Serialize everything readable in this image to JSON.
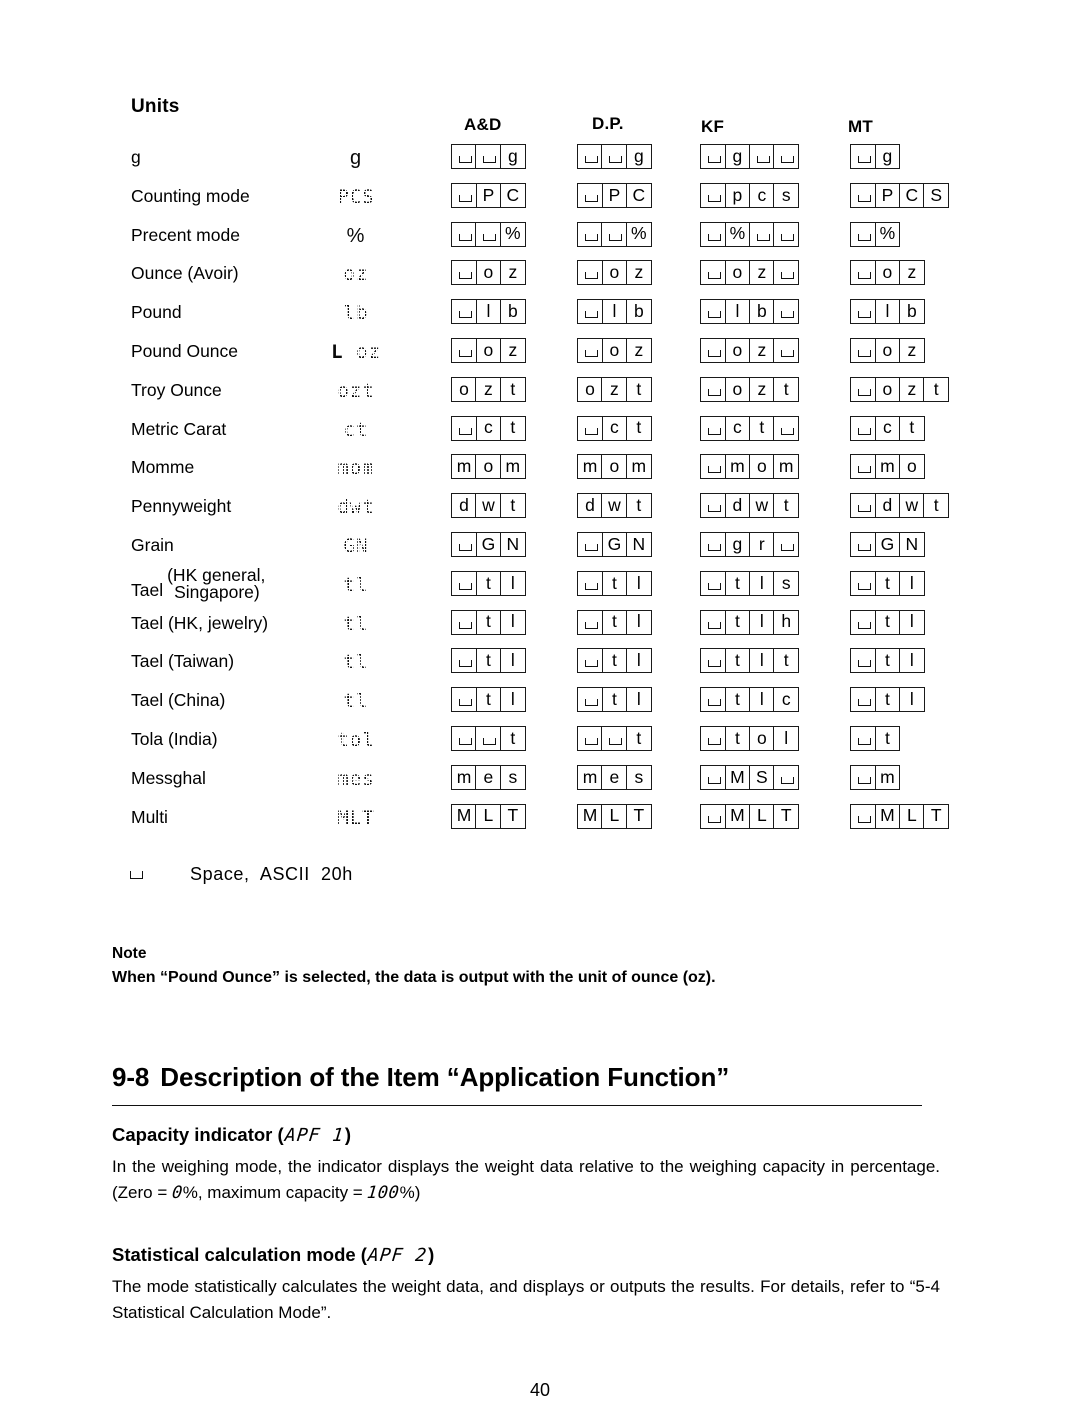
{
  "units": {
    "title": "Units",
    "column_headers": [
      "A&D",
      "D.P.",
      "KF",
      "MT"
    ],
    "rows": [
      {
        "name": "g",
        "lcd": "g",
        "lcd_style": "plain",
        "ad": [
          "_",
          "_",
          "g"
        ],
        "dp": [
          "_",
          "_",
          "g"
        ],
        "kf": [
          "_",
          "g",
          "_",
          "_"
        ],
        "mt": [
          "_",
          "g"
        ]
      },
      {
        "name": "Counting mode",
        "lcd": "PCS",
        "lcd_style": "dot",
        "ad": [
          "_",
          "P",
          "C"
        ],
        "dp": [
          "_",
          "P",
          "C"
        ],
        "kf": [
          "_",
          "p",
          "c",
          "s"
        ],
        "mt": [
          "_",
          "P",
          "C",
          "S"
        ]
      },
      {
        "name": "Precent mode",
        "lcd": "%",
        "lcd_style": "plain",
        "ad": [
          "_",
          "_",
          "%"
        ],
        "dp": [
          "_",
          "_",
          "%"
        ],
        "kf": [
          "_",
          "%",
          "_",
          "_"
        ],
        "mt": [
          "_",
          "%"
        ]
      },
      {
        "name": "Ounce (Avoir)",
        "lcd": "oz",
        "lcd_style": "dot",
        "ad": [
          "_",
          "o",
          "z"
        ],
        "dp": [
          "_",
          "o",
          "z"
        ],
        "kf": [
          "_",
          "o",
          "z",
          "_"
        ],
        "mt": [
          "_",
          "o",
          "z"
        ]
      },
      {
        "name": "Pound",
        "lcd": "lb",
        "lcd_style": "dot",
        "ad": [
          "_",
          "l",
          "b"
        ],
        "dp": [
          "_",
          "l",
          "b"
        ],
        "kf": [
          "_",
          "l",
          "b",
          "_"
        ],
        "mt": [
          "_",
          "l",
          "b"
        ]
      },
      {
        "name": "Pound Ounce",
        "lcd": "L oz",
        "lcd_style": "dot-L",
        "ad": [
          "_",
          "o",
          "z"
        ],
        "dp": [
          "_",
          "o",
          "z"
        ],
        "kf": [
          "_",
          "o",
          "z",
          "_"
        ],
        "mt": [
          "_",
          "o",
          "z"
        ]
      },
      {
        "name": "Troy Ounce",
        "lcd": "ozt",
        "lcd_style": "dot",
        "ad": [
          "o",
          "z",
          "t"
        ],
        "dp": [
          "o",
          "z",
          "t"
        ],
        "kf": [
          "_",
          "o",
          "z",
          "t"
        ],
        "mt": [
          "_",
          "o",
          "z",
          "t"
        ]
      },
      {
        "name": "Metric Carat",
        "lcd": "ct",
        "lcd_style": "dot",
        "ad": [
          "_",
          "c",
          "t"
        ],
        "dp": [
          "_",
          "c",
          "t"
        ],
        "kf": [
          "_",
          "c",
          "t",
          "_"
        ],
        "mt": [
          "_",
          "c",
          "t"
        ]
      },
      {
        "name": "Momme",
        "lcd": "mom",
        "lcd_style": "dot",
        "ad": [
          "m",
          "o",
          "m"
        ],
        "dp": [
          "m",
          "o",
          "m"
        ],
        "kf": [
          "_",
          "m",
          "o",
          "m"
        ],
        "mt": [
          "_",
          "m",
          "o"
        ]
      },
      {
        "name": "Pennyweight",
        "lcd": "dwt",
        "lcd_style": "dot",
        "ad": [
          "d",
          "w",
          "t"
        ],
        "dp": [
          "d",
          "w",
          "t"
        ],
        "kf": [
          "_",
          "d",
          "w",
          "t"
        ],
        "mt": [
          "_",
          "d",
          "w",
          "t"
        ]
      },
      {
        "name": "Grain",
        "lcd": "GN",
        "lcd_style": "dot",
        "ad": [
          "_",
          "G",
          "N"
        ],
        "dp": [
          "_",
          "G",
          "N"
        ],
        "kf": [
          "_",
          "g",
          "r",
          "_"
        ],
        "mt": [
          "_",
          "G",
          "N"
        ]
      },
      {
        "name": "Tael",
        "name_paren_line1": "(HK general,",
        "name_paren_line2": "Singapore)",
        "lcd": "tl",
        "lcd_style": "dot",
        "ad": [
          "_",
          "t",
          "l"
        ],
        "dp": [
          "_",
          "t",
          "l"
        ],
        "kf": [
          "_",
          "t",
          "l",
          "s"
        ],
        "mt": [
          "_",
          "t",
          "l"
        ]
      },
      {
        "name": "Tael (HK, jewelry)",
        "lcd": "tl",
        "lcd_style": "dot",
        "ad": [
          "_",
          "t",
          "l"
        ],
        "dp": [
          "_",
          "t",
          "l"
        ],
        "kf": [
          "_",
          "t",
          "l",
          "h"
        ],
        "mt": [
          "_",
          "t",
          "l"
        ]
      },
      {
        "name": "Tael (Taiwan)",
        "lcd": "tl",
        "lcd_style": "dot",
        "ad": [
          "_",
          "t",
          "l"
        ],
        "dp": [
          "_",
          "t",
          "l"
        ],
        "kf": [
          "_",
          "t",
          "l",
          "t"
        ],
        "mt": [
          "_",
          "t",
          "l"
        ]
      },
      {
        "name": "Tael (China)",
        "lcd": "tl",
        "lcd_style": "dot",
        "ad": [
          "_",
          "t",
          "l"
        ],
        "dp": [
          "_",
          "t",
          "l"
        ],
        "kf": [
          "_",
          "t",
          "l",
          "c"
        ],
        "mt": [
          "_",
          "t",
          "l"
        ]
      },
      {
        "name": "Tola (India)",
        "lcd": "tol",
        "lcd_style": "dot",
        "ad": [
          "_",
          "_",
          "t"
        ],
        "dp": [
          "_",
          "_",
          "t"
        ],
        "kf": [
          "_",
          "t",
          "o",
          "l"
        ],
        "mt": [
          "_",
          "t"
        ]
      },
      {
        "name": "Messghal",
        "lcd": "mes",
        "lcd_style": "dot",
        "ad": [
          "m",
          "e",
          "s"
        ],
        "dp": [
          "m",
          "e",
          "s"
        ],
        "kf": [
          "_",
          "M",
          "S",
          "_"
        ],
        "mt": [
          "_",
          "m"
        ]
      },
      {
        "name": "Multi",
        "lcd": "MLT",
        "lcd_style": "dot",
        "ad": [
          "M",
          "L",
          "T"
        ],
        "dp": [
          "M",
          "L",
          "T"
        ],
        "kf": [
          "_",
          "M",
          "L",
          "T"
        ],
        "mt": [
          "_",
          "M",
          "L",
          "T"
        ]
      }
    ]
  },
  "space_legend": {
    "glyph_name": "space-symbol",
    "text": "Space,  ASCII  20h"
  },
  "note": {
    "title": "Note",
    "body": "When “Pound Ounce” is selected, the data is output with the unit of ounce (oz)."
  },
  "section": {
    "number": "9-8",
    "title": "Description of the Item “Application Function”"
  },
  "capacity_indicator": {
    "heading_prefix": "Capacity indicator (",
    "heading_code": "APF  1",
    "heading_suffix": ")",
    "para_part1": "In the weighing mode, the indicator displays the weight data relative to the weighing capacity in percentage. (Zero = ",
    "para_code1": "0",
    "para_part2": "%, maximum capacity = ",
    "para_code2": "100",
    "para_part3": "%)"
  },
  "statistical_mode": {
    "heading_prefix": "Statistical calculation mode (",
    "heading_code": "APF  2",
    "heading_suffix": ")",
    "para": "The mode statistically calculates the weight data, and displays or outputs the results. For details, refer to “5-4 Statistical Calculation Mode”."
  },
  "page_number": "40"
}
